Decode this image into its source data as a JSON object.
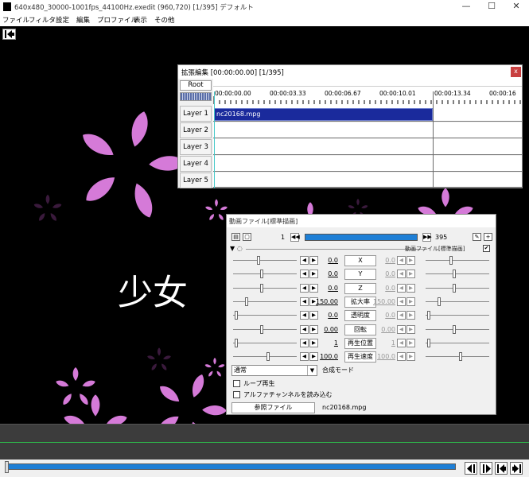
{
  "window": {
    "title": "640x480_30000-1001fps_44100Hz.exedit (960,720)  [1/395]  デフォルト",
    "controls": {
      "minimize": "—",
      "maximize": "☐",
      "close": "✕"
    }
  },
  "menu": [
    "ファイル",
    "フィルタ",
    "設定",
    "編集",
    "プロファイル",
    "表示",
    "その他"
  ],
  "preview": {
    "overlay_text": "少女",
    "petal_color": "#d57ad8"
  },
  "timeline_window": {
    "title": "拡張編集 [00:00:00.00] [1/395]",
    "close_label": "x",
    "root_label": "Root",
    "ruler_ticks": [
      "00:00:00.00",
      "00:00:03.33",
      "00:00:06.67",
      "00:00:10.01",
      "00:00:13.34",
      "00:00:16"
    ],
    "layers": [
      "Layer 1",
      "Layer 2",
      "Layer 3",
      "Layer 4",
      "Layer 5"
    ],
    "clip_label": "nc20168.mpg",
    "clip_color": "#1a2a9c"
  },
  "object_dialog": {
    "title": "動画ファイル[標準描画]",
    "frame_start": "1",
    "frame_end": "395",
    "filter_name": "動画ファイル[標準描画]",
    "params": [
      {
        "name": "X",
        "left": "0.0",
        "right": "0.0",
        "left_pos": 0.4,
        "right_pos": 0.4
      },
      {
        "name": "Y",
        "left": "0.0",
        "right": "0.0",
        "left_pos": 0.45,
        "right_pos": 0.45
      },
      {
        "name": "Z",
        "left": "0.0",
        "right": "0.0",
        "left_pos": 0.45,
        "right_pos": 0.45
      },
      {
        "name": "拡大率",
        "left": "150.00",
        "right": "150.00",
        "left_pos": 0.2,
        "right_pos": 0.2
      },
      {
        "name": "透明度",
        "left": "0.0",
        "right": "0.0",
        "left_pos": 0.02,
        "right_pos": 0.02
      },
      {
        "name": "回転",
        "left": "0.00",
        "right": "0.00",
        "left_pos": 0.45,
        "right_pos": 0.45
      },
      {
        "name": "再生位置",
        "left": "1",
        "right": "1",
        "left_pos": 0.02,
        "right_pos": 0.02
      },
      {
        "name": "再生速度",
        "left": "100.0",
        "right": "100.0",
        "left_pos": 0.55,
        "right_pos": 0.55
      }
    ],
    "blend_mode": "通常",
    "blend_label": "合成モード",
    "loop_label": "ループ再生",
    "alpha_label": "アルファチャンネルを読み込む",
    "ref_button": "参照ファイル",
    "file_name": "nc20168.mpg"
  },
  "playback": {
    "progress": 0.97
  }
}
